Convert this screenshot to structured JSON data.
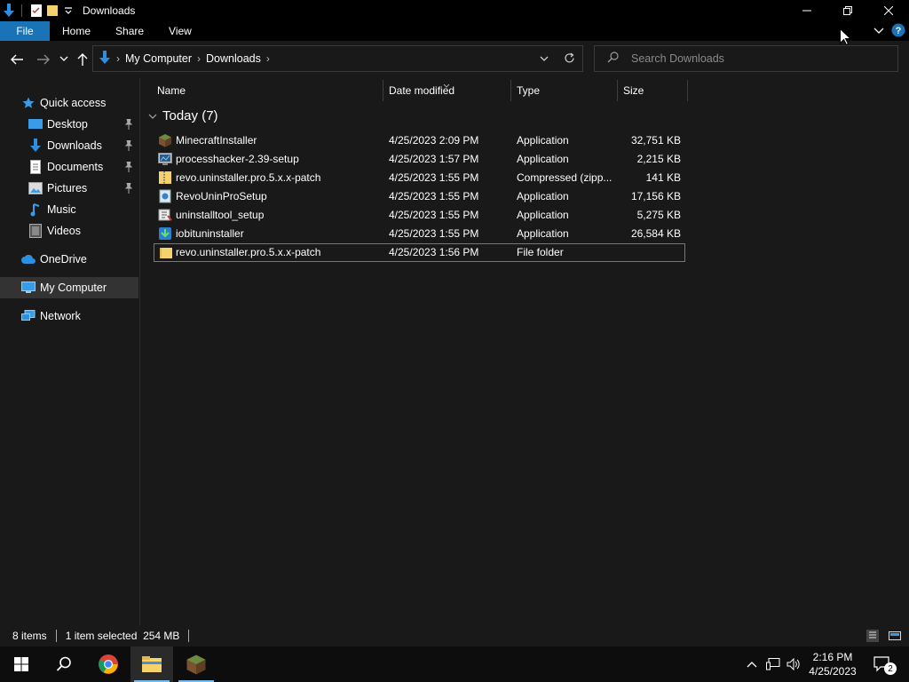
{
  "window": {
    "title": "Downloads"
  },
  "ribbon": {
    "tabs": [
      "File",
      "Home",
      "Share",
      "View"
    ]
  },
  "address": {
    "crumbs": [
      "My Computer",
      "Downloads"
    ]
  },
  "search": {
    "placeholder": "Search Downloads"
  },
  "sidebar": {
    "items": [
      {
        "label": "Quick access",
        "icon": "star-icon"
      },
      {
        "label": "Desktop",
        "icon": "desktop-icon",
        "pinned": true
      },
      {
        "label": "Downloads",
        "icon": "download-icon",
        "pinned": true
      },
      {
        "label": "Documents",
        "icon": "document-icon",
        "pinned": true
      },
      {
        "label": "Pictures",
        "icon": "picture-icon",
        "pinned": true
      },
      {
        "label": "Music",
        "icon": "music-icon"
      },
      {
        "label": "Videos",
        "icon": "video-icon"
      },
      {
        "label": "OneDrive",
        "icon": "cloud-icon"
      },
      {
        "label": "My Computer",
        "icon": "computer-icon",
        "selected": true
      },
      {
        "label": "Network",
        "icon": "network-icon"
      }
    ]
  },
  "columns": [
    "Name",
    "Date modified",
    "Type",
    "Size"
  ],
  "group": {
    "label": "Today (7)"
  },
  "files": [
    {
      "name": "MinecraftInstaller",
      "date": "4/25/2023 2:09 PM",
      "type": "Application",
      "size": "32,751 KB",
      "icon": "minecraft-icon"
    },
    {
      "name": "processhacker-2.39-setup",
      "date": "4/25/2023 1:57 PM",
      "type": "Application",
      "size": "2,215 KB",
      "icon": "installer-icon"
    },
    {
      "name": "revo.uninstaller.pro.5.x.x-patch",
      "date": "4/25/2023 1:55 PM",
      "type": "Compressed (zipp...",
      "size": "141 KB",
      "icon": "zip-icon"
    },
    {
      "name": "RevoUninProSetup",
      "date": "4/25/2023 1:55 PM",
      "type": "Application",
      "size": "17,156 KB",
      "icon": "setup-icon"
    },
    {
      "name": "uninstalltool_setup",
      "date": "4/25/2023 1:55 PM",
      "type": "Application",
      "size": "5,275 KB",
      "icon": "setup-icon"
    },
    {
      "name": "iobituninstaller",
      "date": "4/25/2023 1:55 PM",
      "type": "Application",
      "size": "26,584 KB",
      "icon": "iobit-icon"
    },
    {
      "name": "revo.uninstaller.pro.5.x.x-patch",
      "date": "4/25/2023 1:56 PM",
      "type": "File folder",
      "size": "",
      "icon": "folder-icon",
      "selected": true
    }
  ],
  "status": {
    "count": "8 items",
    "selection": "1 item selected  254 MB"
  },
  "taskbar": {
    "time": "2:16 PM",
    "date": "4/25/2023",
    "notifications": "2"
  },
  "colors": {
    "accent": "#1a72b7",
    "background": "#191919",
    "folder": "#f5d26b"
  }
}
